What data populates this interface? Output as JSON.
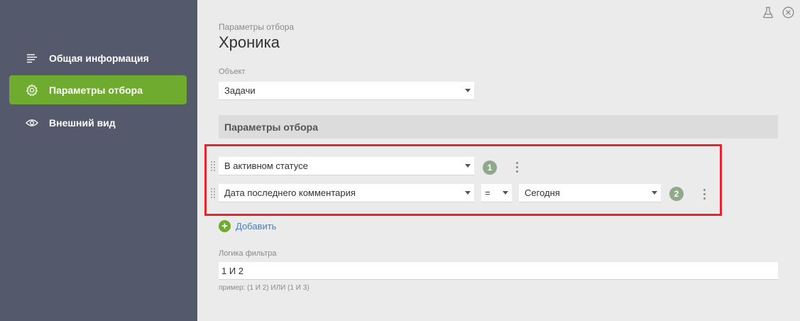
{
  "sidebar": {
    "items": [
      {
        "label": "Общая информация",
        "icon": "list-icon",
        "active": false
      },
      {
        "label": "Параметры отбора",
        "icon": "gear-icon",
        "active": true
      },
      {
        "label": "Внешний вид",
        "icon": "eye-icon",
        "active": false
      }
    ]
  },
  "top_icons": [
    "flask-icon",
    "close-icon"
  ],
  "page": {
    "subtitle": "Параметры отбора",
    "title": "Хроника"
  },
  "object_field": {
    "label": "Объект",
    "value": "Задачи"
  },
  "filters_section": {
    "header": "Параметры отбора",
    "rows": [
      {
        "field": "В активном статусе",
        "number": "1"
      },
      {
        "field": "Дата последнего комментария",
        "operator": "=",
        "value": "Сегодня",
        "number": "2"
      }
    ],
    "add_label": "Добавить"
  },
  "filter_logic": {
    "label": "Логика фильтра",
    "value": "1 И 2",
    "hint": "пример: (1 И 2) ИЛИ (1 И 3)"
  },
  "colors": {
    "sidebar_bg": "#545a6c",
    "accent_green": "#6fab2f",
    "highlight_red": "#e52530",
    "badge_green": "#8fa98a",
    "link_blue": "#4a7fb5"
  }
}
